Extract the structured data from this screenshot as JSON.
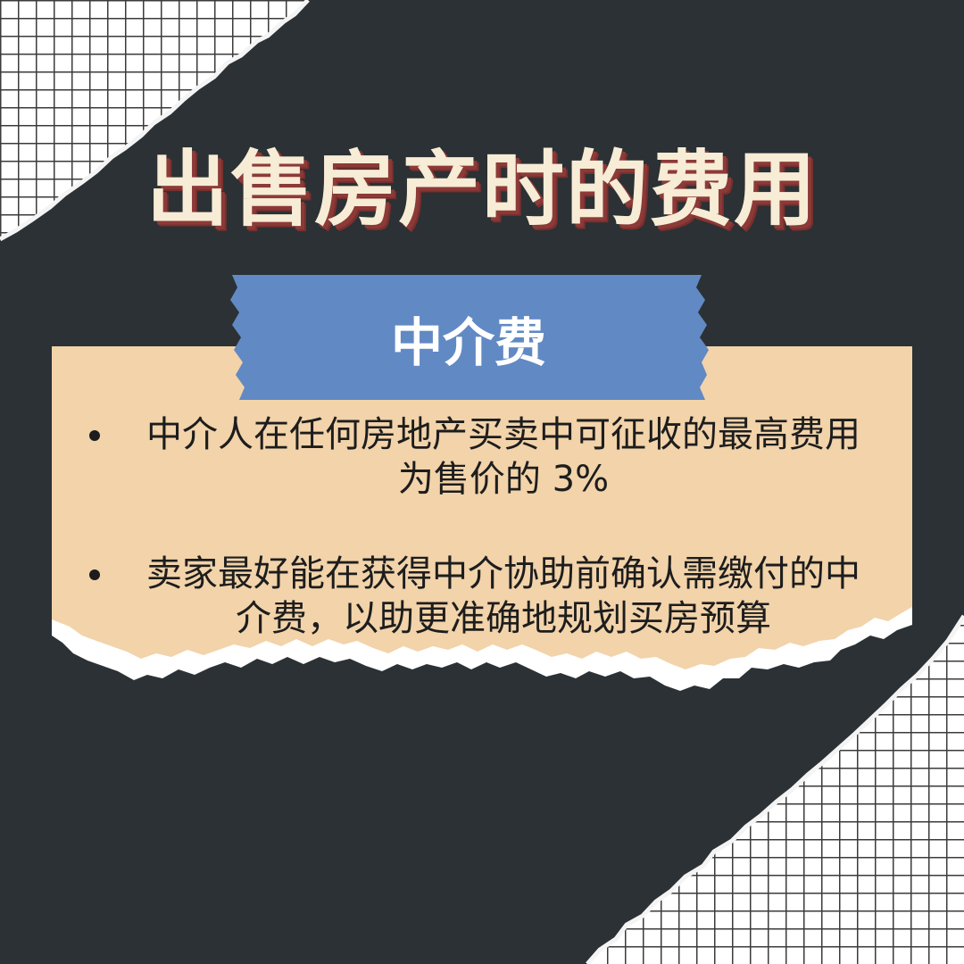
{
  "poster": {
    "title": "出售房产时的费用",
    "section_label": "中介费",
    "bullets": [
      "中介人在任何房地产买卖中可征收的最高费用为售价的 3%",
      "卖家最好能在获得中介协助前确认需缴付的中介费，以助更准确地规划买房预算"
    ]
  },
  "colors": {
    "background": "#2b3134",
    "grid_paper": "#ffffff",
    "grid_lines": "#3b3b3b",
    "title_text": "#f7ecd6",
    "title_shadow": "#8c3a38",
    "tape": "#6189c4",
    "card": "#f2d3aa",
    "body_text": "#1d1d1d"
  }
}
